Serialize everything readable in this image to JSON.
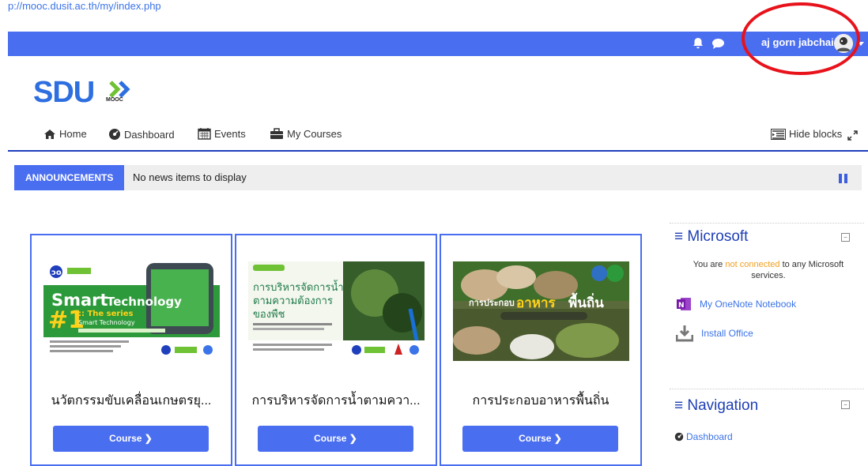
{
  "top_link": "p://mooc.dusit.ac.th/my/index.php",
  "topbar": {
    "user_name": "aj gorn jabchai"
  },
  "logo": {
    "main": "SDU",
    "sub": "MOOC"
  },
  "nav": {
    "items": [
      {
        "label": "Home",
        "icon": "home-icon"
      },
      {
        "label": "Dashboard",
        "icon": "dashboard-icon"
      },
      {
        "label": "Events",
        "icon": "calendar-icon"
      },
      {
        "label": "My Courses",
        "icon": "briefcase-icon"
      }
    ],
    "hide_blocks": "Hide blocks"
  },
  "announcements": {
    "label": "ANNOUNCEMENTS",
    "text": "No news items to display"
  },
  "courses": [
    {
      "title": "นวัตกรรมขับเคลื่อนเกษตรยุ...",
      "button": "Course ❯",
      "thumb_text": "Smart Technology"
    },
    {
      "title": "การบริหารจัดการน้ำตามควา...",
      "button": "Course ❯",
      "thumb_text": "การบริหารจัดการน้ำ ตามความต้องการ ของพืช"
    },
    {
      "title": "การประกอบอาหารพื้นถิ่น",
      "button": "Course ❯",
      "thumb_text": "การประกอบอาหารพื้นถิ่น"
    }
  ],
  "microsoft": {
    "title": "Microsoft",
    "status_prefix": "You are",
    "status_highlight": "not connected",
    "status_suffix": "to any Microsoft services.",
    "onenote": "My OneNote Notebook",
    "install": "Install Office"
  },
  "navigation": {
    "title": "Navigation",
    "dashboard": "Dashboard"
  },
  "colors": {
    "brand": "#4a6ef0",
    "accent_red": "#e8121b",
    "warning": "#f0a020"
  }
}
